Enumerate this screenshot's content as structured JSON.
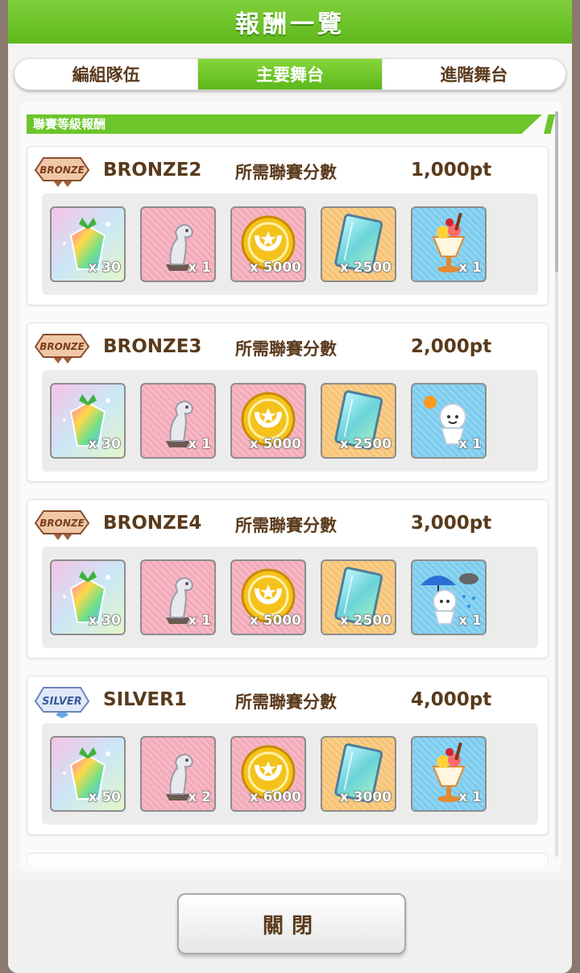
{
  "header": {
    "title": "報酬一覽"
  },
  "tabs": [
    {
      "label": "編組隊伍",
      "active": false
    },
    {
      "label": "主要舞台",
      "active": true
    },
    {
      "label": "進階舞台",
      "active": false
    }
  ],
  "section": {
    "title": "聯賽等級報酬"
  },
  "requirement_label": "所需聯賽分數",
  "tiers": [
    {
      "badge": "BRONZE",
      "name": "BRONZE2",
      "points": "1,000pt",
      "items": [
        {
          "icon": "rainbow-crystal-icon",
          "count": "x 30"
        },
        {
          "icon": "horse-statue-icon",
          "count": "x 1"
        },
        {
          "icon": "gold-coin-icon",
          "count": "x 5000"
        },
        {
          "icon": "crystal-card-icon",
          "count": "x 2500"
        },
        {
          "icon": "parfait-icon",
          "count": "x 1"
        }
      ]
    },
    {
      "badge": "BRONZE",
      "name": "BRONZE3",
      "points": "2,000pt",
      "items": [
        {
          "icon": "rainbow-crystal-icon",
          "count": "x 30"
        },
        {
          "icon": "horse-statue-icon",
          "count": "x 1"
        },
        {
          "icon": "gold-coin-icon",
          "count": "x 5000"
        },
        {
          "icon": "crystal-card-icon",
          "count": "x 2500"
        },
        {
          "icon": "sunny-doll-icon",
          "count": "x 1"
        }
      ]
    },
    {
      "badge": "BRONZE",
      "name": "BRONZE4",
      "points": "3,000pt",
      "items": [
        {
          "icon": "rainbow-crystal-icon",
          "count": "x 30"
        },
        {
          "icon": "horse-statue-icon",
          "count": "x 1"
        },
        {
          "icon": "gold-coin-icon",
          "count": "x 5000"
        },
        {
          "icon": "crystal-card-icon",
          "count": "x 2500"
        },
        {
          "icon": "rain-doll-icon",
          "count": "x 1"
        }
      ]
    },
    {
      "badge": "SILVER",
      "name": "SILVER1",
      "points": "4,000pt",
      "items": [
        {
          "icon": "rainbow-crystal-icon",
          "count": "x 50"
        },
        {
          "icon": "horse-statue-icon",
          "count": "x 2"
        },
        {
          "icon": "gold-coin-icon",
          "count": "x 6000"
        },
        {
          "icon": "crystal-card-icon",
          "count": "x 3000"
        },
        {
          "icon": "parfait-icon",
          "count": "x 1"
        }
      ]
    }
  ],
  "footer": {
    "close_label": "關閉"
  },
  "colors": {
    "accent_green": "#6cc52a",
    "text_brown": "#5a3a1c"
  }
}
